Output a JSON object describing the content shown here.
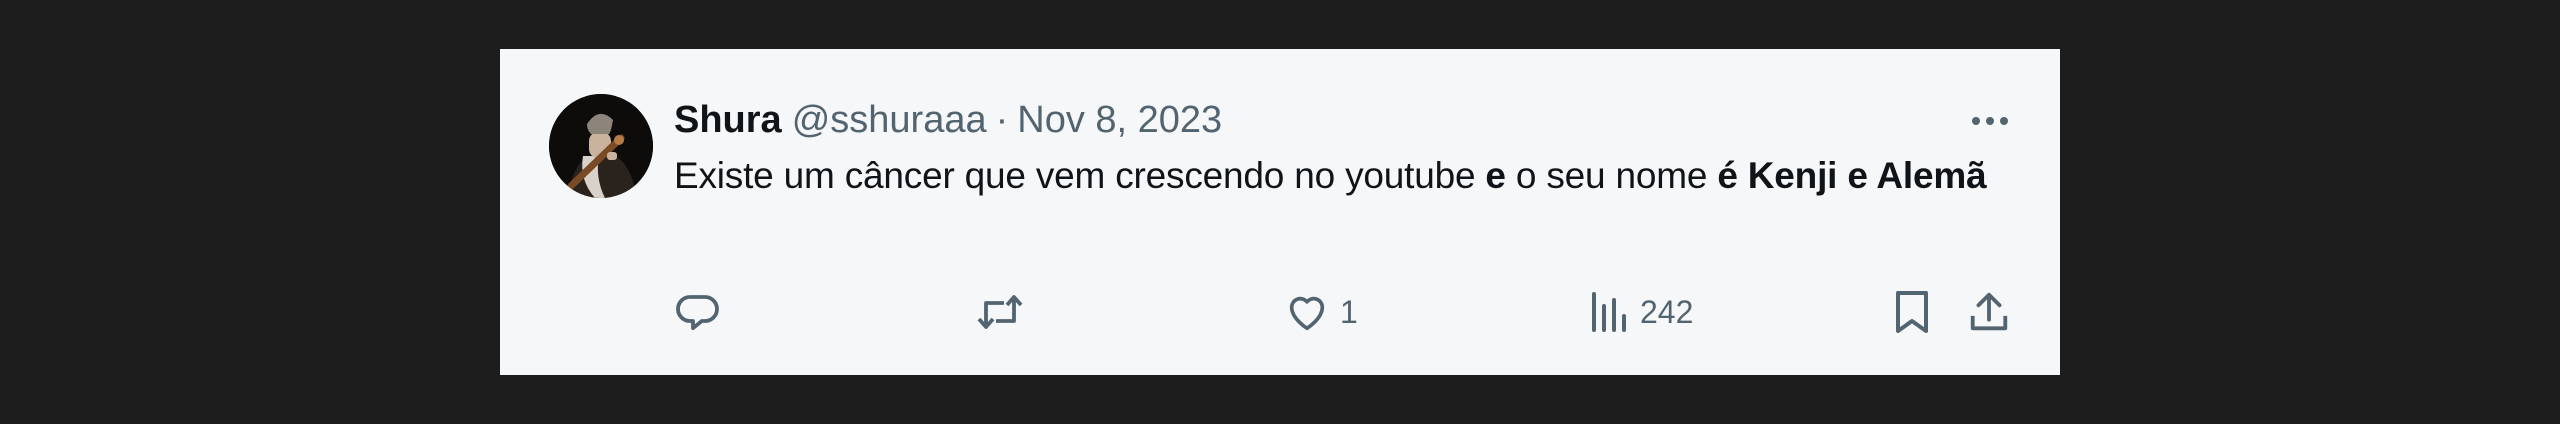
{
  "tweet": {
    "display_name": "Shura",
    "handle": "@sshuraaa",
    "separator": "·",
    "date": "Nov 8, 2023",
    "text_parts": {
      "p1": "Existe um câncer que vem crescendo no youtube ",
      "p2": "e",
      "p3": " o seu nome ",
      "p4": "é Kenji e Alemã"
    }
  },
  "actions": {
    "reply_icon": "reply-icon",
    "retweet_icon": "retweet-icon",
    "like_icon": "heart-icon",
    "like_count": "1",
    "views_icon": "views-bar-icon",
    "views_count": "242",
    "bookmark_icon": "bookmark-icon",
    "share_icon": "share-icon",
    "more_icon": "more-dots-icon"
  },
  "colors": {
    "background": "#1d1d1d",
    "card": "#f6f7f8",
    "text": "#0f1419",
    "secondary": "#536471"
  }
}
